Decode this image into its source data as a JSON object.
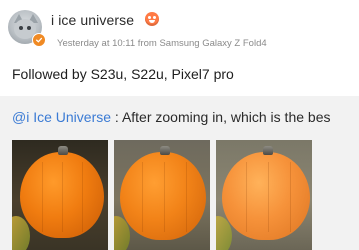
{
  "post": {
    "username": "i ice universe",
    "meta": "Yesterday at 10:11 from Samsung Galaxy Z Fold4",
    "text": "Followed by S23u, S22u, Pixel7 pro"
  },
  "quote": {
    "mention": "@i Ice Universe",
    "separator": " : ",
    "text": "After zooming in, which is the bes"
  },
  "photos": [
    {
      "label": "photo-1"
    },
    {
      "label": "photo-2"
    },
    {
      "label": "photo-3"
    }
  ],
  "colors": {
    "mention": "#3b7bd4",
    "meta": "#8a8a8a",
    "quote_bg": "#f2f2f2",
    "verified": "#f08a24"
  },
  "icons": {
    "avatar": "cat-avatar",
    "verified": "verified-badge-icon",
    "level": "emoji-badge-icon"
  }
}
